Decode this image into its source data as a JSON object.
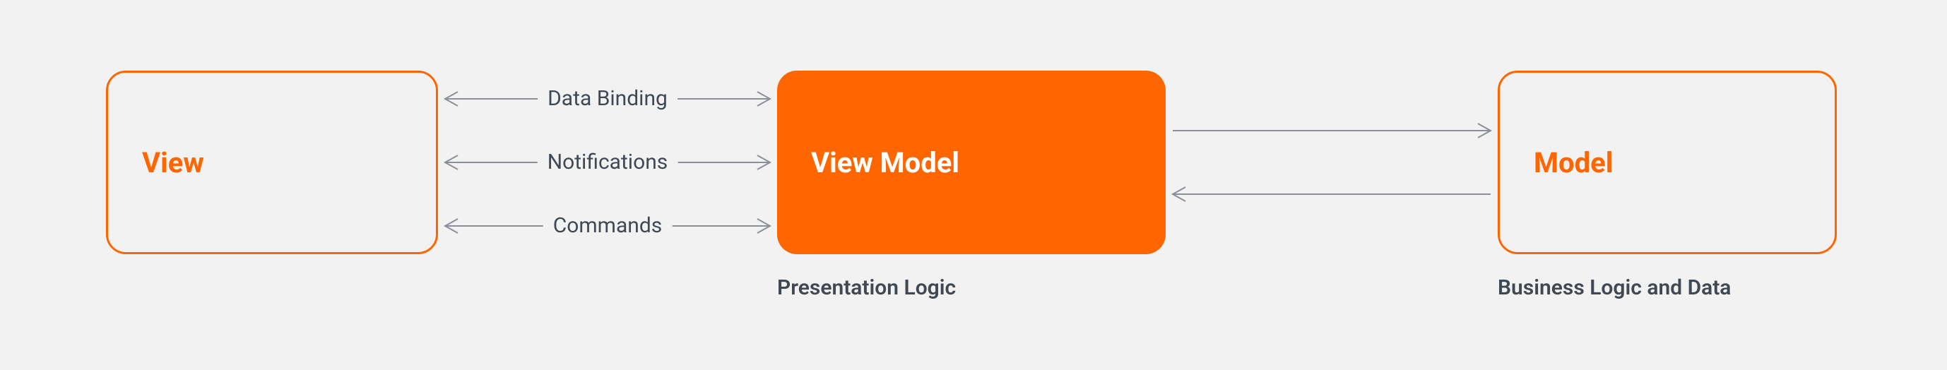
{
  "diagram": {
    "nodes": {
      "view": {
        "label": "View"
      },
      "viewmodel": {
        "label": "View Model",
        "caption": "Presentation Logic"
      },
      "model": {
        "label": "Model",
        "caption": "Business Logic and Data"
      }
    },
    "edges": {
      "view_vm": {
        "data_binding": "Data Binding",
        "notifications": "Notifications",
        "commands": "Commands"
      }
    },
    "colors": {
      "accent": "#ff6600",
      "background": "#f2f2f2",
      "text_muted": "#404854",
      "arrow": "#8a8f98"
    }
  }
}
